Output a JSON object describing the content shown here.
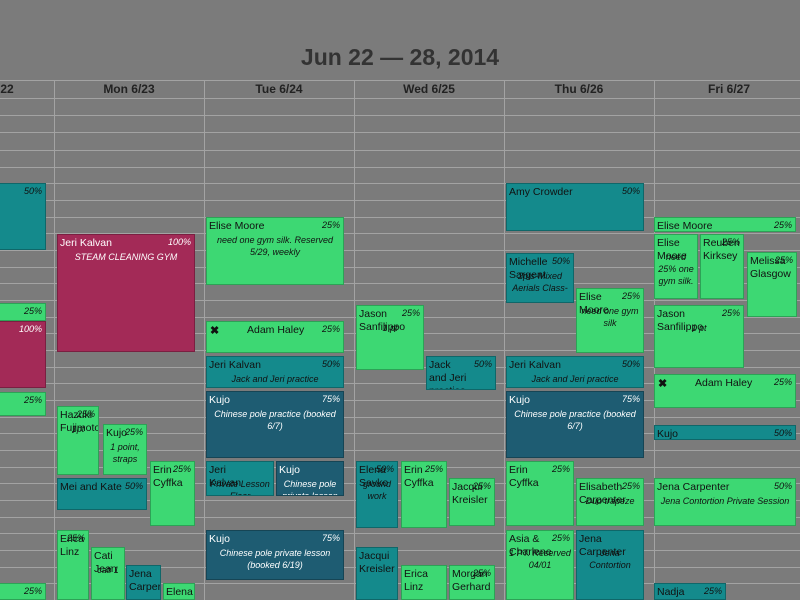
{
  "title": "Jun 22 — 28, 2014",
  "colors": {
    "teal": "#148a8c",
    "green": "#3dd873",
    "maroon": "#a32a57",
    "navy": "#1e5c72",
    "background": "#7b7b7b"
  },
  "days": [
    {
      "label": "22"
    },
    {
      "label": "Mon 6/23"
    },
    {
      "label": "Tue 6/24"
    },
    {
      "label": "Wed 6/25"
    },
    {
      "label": "Thu 6/26"
    },
    {
      "label": "Fri 6/27"
    }
  ],
  "events": [
    {
      "name": "",
      "pct": "50%",
      "note": "",
      "color": "teal"
    },
    {
      "name": "",
      "pct": "25%",
      "note": "",
      "color": "green"
    },
    {
      "name": "",
      "pct": "100%",
      "note": "",
      "color": "maroon"
    },
    {
      "name": "",
      "pct": "25%",
      "note": "",
      "color": "green"
    },
    {
      "name": "",
      "pct": "25%",
      "note": "",
      "color": "green"
    },
    {
      "name": "Jeri Kalvan",
      "pct": "100%",
      "note": "STEAM CLEANING GYM",
      "color": "maroon"
    },
    {
      "name": "Hazuki Fujimoto",
      "pct": "25%",
      "note": "1pt",
      "color": "green"
    },
    {
      "name": "Kujo",
      "pct": "25%",
      "note": "1 point, straps",
      "color": "green"
    },
    {
      "name": "Erin Cyffka",
      "pct": "25%",
      "note": "",
      "color": "green"
    },
    {
      "name": "Mei and Kate",
      "pct": "50%",
      "note": "",
      "color": "teal"
    },
    {
      "name": "Erica Linz",
      "pct": "25%",
      "note": "",
      "color": "green"
    },
    {
      "name": "Cati Jean",
      "pct": "",
      "note": "cati 1",
      "color": "green"
    },
    {
      "name": "Jena Carper",
      "pct": "",
      "note": "",
      "color": "teal"
    },
    {
      "name": "Elena",
      "pct": "",
      "note": "",
      "color": "green"
    },
    {
      "name": "Elise Moore",
      "pct": "25%",
      "note": "need one gym silk. Reserved 5/29, weekly",
      "color": "green"
    },
    {
      "name": "Adam Haley",
      "pct": "25%",
      "note": "",
      "color": "green"
    },
    {
      "name": "Jeri Kalvan",
      "pct": "50%",
      "note": "Jack and Jeri practice",
      "color": "teal"
    },
    {
      "name": "Kujo",
      "pct": "75%",
      "note": "Chinese pole practice (booked 6/7)",
      "color": "navy"
    },
    {
      "name": "Jeri Kalvan",
      "pct": "",
      "note": "Private Lesson Floor",
      "color": "teal"
    },
    {
      "name": "Kujo",
      "pct": "",
      "note": "Chinese pole private lesson",
      "color": "navy"
    },
    {
      "name": "Kujo",
      "pct": "75%",
      "note": "Chinese pole private lesson (booked 6/19)",
      "color": "navy"
    },
    {
      "name": "Jason Sanfilippo",
      "pct": "25%",
      "note": "1 pt",
      "color": "green"
    },
    {
      "name": "Jack and Jeri practice",
      "pct": "50%",
      "note": "",
      "color": "teal"
    },
    {
      "name": "Elena Savko",
      "pct": "50%",
      "note": "ground work",
      "color": "teal"
    },
    {
      "name": "Erin Cyffka",
      "pct": "25%",
      "note": "",
      "color": "green"
    },
    {
      "name": "Jacqui Kreisler",
      "pct": "25%",
      "note": "",
      "color": "green"
    },
    {
      "name": "Jacqui Kreisler",
      "pct": "",
      "note": "",
      "color": "teal"
    },
    {
      "name": "Erica Linz",
      "pct": "",
      "note": "",
      "color": "green"
    },
    {
      "name": "Morgan Gerhard",
      "pct": "25%",
      "note": "",
      "color": "green"
    },
    {
      "name": "Amy Crowder",
      "pct": "50%",
      "note": "",
      "color": "teal"
    },
    {
      "name": "Michelle Sargent",
      "pct": "50%",
      "note": "2pts-Mixed Aerials Class-",
      "color": "teal"
    },
    {
      "name": "Elise Moore",
      "pct": "25%",
      "note": "need one gym silk",
      "color": "green"
    },
    {
      "name": "Jeri Kalvan",
      "pct": "50%",
      "note": "Jack and Jeri practice",
      "color": "teal"
    },
    {
      "name": "Kujo",
      "pct": "75%",
      "note": "Chinese pole practice (booked 6/7)",
      "color": "navy"
    },
    {
      "name": "Erin Cyffka",
      "pct": "25%",
      "note": "",
      "color": "green"
    },
    {
      "name": "Elisabeth Carpenter",
      "pct": "25%",
      "note": "Duo trapeze",
      "color": "green"
    },
    {
      "name": "Asia & Charlene",
      "pct": "25%",
      "note": "1 PT. Reserved 04/01",
      "color": "green"
    },
    {
      "name": "Jena Carpenter",
      "pct": "",
      "note": "Jena Contortion",
      "color": "teal"
    },
    {
      "name": "Elise Moore",
      "pct": "25%",
      "note": "",
      "color": "green"
    },
    {
      "name": "Elise Moore",
      "pct": "",
      "note": "need 25% one gym silk.",
      "color": "green"
    },
    {
      "name": "Reuben Kirksey",
      "pct": "25%",
      "note": "",
      "color": "green"
    },
    {
      "name": "Melissa Glasgow",
      "pct": "25%",
      "note": "",
      "color": "green"
    },
    {
      "name": "Jason Sanfilippo",
      "pct": "25%",
      "note": "1 pt",
      "color": "green"
    },
    {
      "name": "Adam Haley",
      "pct": "25%",
      "note": "",
      "color": "green"
    },
    {
      "name": "Kujo",
      "pct": "50%",
      "note": "",
      "color": "teal"
    },
    {
      "name": "Jena Carpenter",
      "pct": "50%",
      "note": "Jena Contortion Private Session",
      "color": "green"
    },
    {
      "name": "Nadja Young",
      "pct": "25%",
      "note": "",
      "color": "teal"
    }
  ]
}
